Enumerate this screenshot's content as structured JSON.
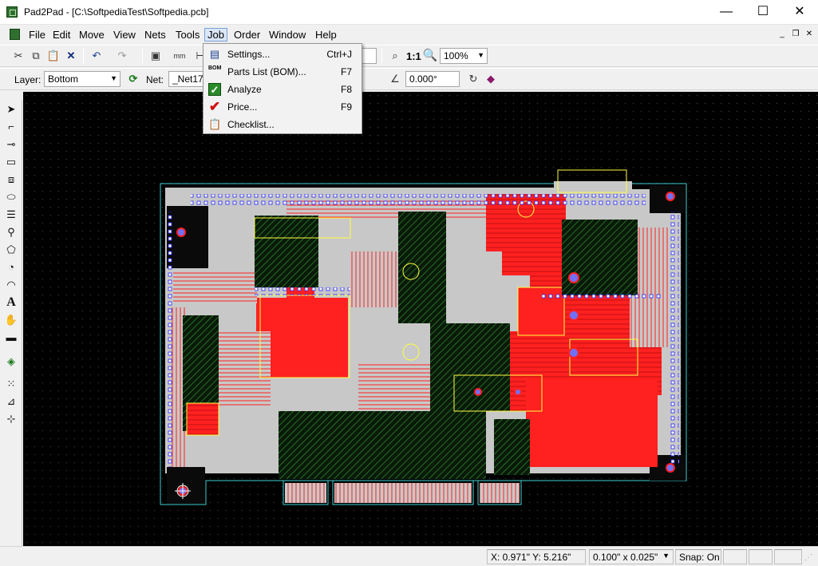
{
  "window": {
    "title": "Pad2Pad - [C:\\SoftpediaTest\\Softpedia.pcb]",
    "minimize": "—",
    "maximize": "☐",
    "close": "✕"
  },
  "menu": {
    "items": [
      "File",
      "Edit",
      "Move",
      "View",
      "Nets",
      "Tools",
      "Job",
      "Order",
      "Window",
      "Help"
    ],
    "mdi_controls": [
      "_",
      "❐",
      "✕"
    ]
  },
  "toolbar": {
    "zoom_one_to_one": "1:1",
    "zoom_level": "100%",
    "layer_label": "Layer:",
    "layer_value": "Bottom",
    "net_label": "Net:",
    "net_value": "_Net17",
    "angle_value": "0.000°"
  },
  "job_menu": {
    "items": [
      {
        "label": "Settings...",
        "shortcut": "Ctrl+J",
        "icon": "settings-icon"
      },
      {
        "label": "Parts List (BOM)...",
        "shortcut": "F7",
        "icon": "bom-icon",
        "icon_text": "BOM"
      },
      {
        "label": "Analyze",
        "shortcut": "F8",
        "icon": "analyze-check-icon"
      },
      {
        "label": "Price...",
        "shortcut": "F9",
        "icon": "price-check-icon"
      },
      {
        "label": "Checklist...",
        "shortcut": "",
        "icon": "checklist-icon"
      }
    ]
  },
  "status": {
    "coords": "X: 0.971\" Y: 5.216\"",
    "grid": "0.100\" x 0.025\"",
    "snap": "Snap: On"
  },
  "colors": {
    "canvas_bg": "#000000",
    "board_fill": "#c8c8c8",
    "copper_red": "#ff2020",
    "trace_green": "#1a6b1a",
    "outline_cyan": "#40d0d0",
    "silkscreen_yellow": "#ffff40",
    "pad_blue": "#2020ff"
  }
}
